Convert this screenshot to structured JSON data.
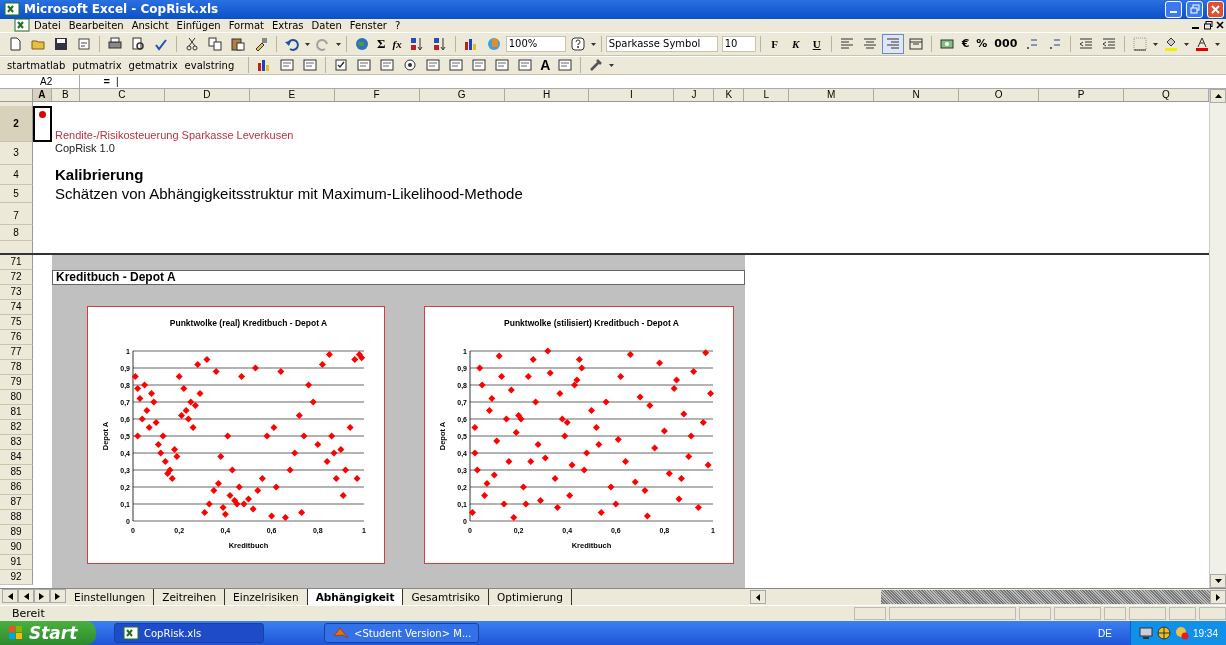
{
  "window": {
    "title": "Microsoft Excel - CopRisk.xls"
  },
  "menu": [
    "Datei",
    "Bearbeiten",
    "Ansicht",
    "Einfügen",
    "Format",
    "Extras",
    "Daten",
    "Fenster",
    "?"
  ],
  "toolbar": {
    "sum": "Σ",
    "function": "fx",
    "zoom": "100%",
    "font": "Sparkasse Symbol",
    "size": "10",
    "format_buttons": [
      {
        "label": "F",
        "kind": "bold"
      },
      {
        "label": "K",
        "kind": "italic"
      },
      {
        "label": "U",
        "kind": "underline"
      }
    ],
    "alignment": [
      {
        "kind": "left",
        "selected": false
      },
      {
        "kind": "center",
        "selected": false
      },
      {
        "kind": "right",
        "selected": true
      },
      {
        "kind": "merge",
        "selected": false
      }
    ],
    "number_buttons": [
      "€",
      "%",
      "000"
    ]
  },
  "macro_buttons": [
    "startmatlab",
    "putmatrix",
    "getmatrix",
    "evalstring"
  ],
  "form_label_glyph": "A",
  "formula_bar": {
    "cell": "A2",
    "equals": "=",
    "value": "|"
  },
  "columns": [
    {
      "label": "A",
      "selected": true
    },
    {
      "label": "B",
      "selected": false
    },
    {
      "label": "C",
      "selected": false
    },
    {
      "label": "D",
      "selected": false
    },
    {
      "label": "E",
      "selected": false
    },
    {
      "label": "F",
      "selected": false
    },
    {
      "label": "G",
      "selected": false
    },
    {
      "label": "H",
      "selected": false
    },
    {
      "label": "I",
      "selected": false
    },
    {
      "label": "J",
      "selected": false
    },
    {
      "label": "K",
      "selected": false
    },
    {
      "label": "L",
      "selected": false
    },
    {
      "label": "M",
      "selected": false
    },
    {
      "label": "N",
      "selected": false
    },
    {
      "label": "O",
      "selected": false
    },
    {
      "label": "P",
      "selected": false
    },
    {
      "label": "Q",
      "selected": false
    }
  ],
  "header_rows": [
    {
      "label": "2",
      "selected": true
    },
    {
      "label": "3",
      "selected": false
    },
    {
      "label": "4",
      "selected": false
    },
    {
      "label": "5",
      "selected": false
    },
    {
      "label": "7",
      "selected": false
    },
    {
      "label": "8",
      "selected": false
    }
  ],
  "title_block": {
    "org": "Rendite-/Risikosteuerung Sparkasse Leverkusen",
    "version": "CopRisk 1.0",
    "heading": "Kalibrierung",
    "subtitle": "Schätzen von Abhängigkeitsstruktur mit Maximum-Likelihood-Methode"
  },
  "lower_rows": [
    "71",
    "72",
    "73",
    "74",
    "75",
    "76",
    "77",
    "78",
    "79",
    "80",
    "81",
    "82",
    "83",
    "84",
    "85",
    "86",
    "87",
    "88",
    "89",
    "90",
    "91",
    "92"
  ],
  "section_title": "Kreditbuch - Depot A",
  "charts": [
    {
      "chart_data": {
        "type": "scatter",
        "grid": true,
        "title": "Punktwolke (real) Kreditbuch - Depot A",
        "xlabel": "Kreditbuch",
        "ylabel": "Depot A",
        "xlim": [
          0,
          1
        ],
        "ylim": [
          0,
          1
        ],
        "xticks": [
          {
            "value": 0,
            "label": "0"
          },
          {
            "value": 0.2,
            "label": "0,2"
          },
          {
            "value": 0.4,
            "label": "0,4"
          },
          {
            "value": 0.6,
            "label": "0,6"
          },
          {
            "value": 0.8,
            "label": "0,8"
          },
          {
            "value": 1,
            "label": "1"
          }
        ],
        "yticks": [
          {
            "value": 0,
            "label": "0"
          },
          {
            "value": 0.1,
            "label": "0,1"
          },
          {
            "value": 0.2,
            "label": "0,2"
          },
          {
            "value": 0.3,
            "label": "0,3"
          },
          {
            "value": 0.4,
            "label": "0,4"
          },
          {
            "value": 0.5,
            "label": "0,5"
          },
          {
            "value": 0.6,
            "label": "0,6"
          },
          {
            "value": 0.7,
            "label": "0,7"
          },
          {
            "value": 0.8,
            "label": "0,8"
          },
          {
            "value": 0.9,
            "label": "0,9"
          },
          {
            "value": 1,
            "label": "1"
          }
        ],
        "x": [
          0.01,
          0.02,
          0.03,
          0.05,
          0.06,
          0.08,
          0.02,
          0.04,
          0.07,
          0.09,
          0.11,
          0.12,
          0.14,
          0.15,
          0.16,
          0.13,
          0.18,
          0.19,
          0.1,
          0.17,
          0.21,
          0.23,
          0.24,
          0.25,
          0.27,
          0.22,
          0.26,
          0.28,
          0.29,
          0.2,
          0.31,
          0.33,
          0.35,
          0.37,
          0.39,
          0.32,
          0.36,
          0.4,
          0.42,
          0.44,
          0.46,
          0.48,
          0.5,
          0.41,
          0.43,
          0.47,
          0.52,
          0.54,
          0.56,
          0.58,
          0.45,
          0.53,
          0.38,
          0.6,
          0.62,
          0.64,
          0.66,
          0.61,
          0.68,
          0.7,
          0.72,
          0.74,
          0.76,
          0.78,
          0.73,
          0.8,
          0.82,
          0.84,
          0.86,
          0.88,
          0.9,
          0.92,
          0.94,
          0.96,
          0.98,
          0.85,
          0.91,
          0.97,
          0.87,
          0.99
        ],
        "series": [
          {
            "color": "#ff0000",
            "values": [
              0.85,
              0.78,
              0.72,
              0.8,
              0.65,
              0.75,
              0.5,
              0.6,
              0.55,
              0.7,
              0.45,
              0.4,
              0.35,
              0.28,
              0.3,
              0.5,
              0.42,
              0.38,
              0.58,
              0.25,
              0.62,
              0.65,
              0.6,
              0.7,
              0.68,
              0.78,
              0.55,
              0.92,
              0.75,
              0.85,
              0.05,
              0.1,
              0.18,
              0.22,
              0.08,
              0.95,
              0.88,
              0.04,
              0.15,
              0.12,
              0.2,
              0.1,
              0.13,
              0.5,
              0.3,
              0.85,
              0.07,
              0.18,
              0.25,
              0.5,
              0.1,
              0.9,
              0.38,
              0.03,
              0.2,
              0.88,
              0.02,
              0.55,
              0.3,
              0.4,
              0.62,
              0.5,
              0.8,
              0.7,
              0.05,
              0.45,
              0.92,
              0.35,
              0.5,
              0.25,
              0.42,
              0.3,
              0.55,
              0.95,
              0.98,
              0.98,
              0.15,
              0.25,
              0.4,
              0.96
            ]
          }
        ]
      }
    },
    {
      "chart_data": {
        "type": "scatter",
        "grid": true,
        "title": "Punktwolke (stilisiert) Kreditbuch - Depot A",
        "xlabel": "Kreditbuch",
        "ylabel": "Depot A",
        "xlim": [
          0,
          1
        ],
        "ylim": [
          0,
          1
        ],
        "xticks": [
          {
            "value": 0,
            "label": "0"
          },
          {
            "value": 0.2,
            "label": "0,2"
          },
          {
            "value": 0.4,
            "label": "0,4"
          },
          {
            "value": 0.6,
            "label": "0,6"
          },
          {
            "value": 0.8,
            "label": "0,8"
          },
          {
            "value": 1,
            "label": "1"
          }
        ],
        "yticks": [
          {
            "value": 0,
            "label": "0"
          },
          {
            "value": 0.1,
            "label": "0,1"
          },
          {
            "value": 0.2,
            "label": "0,2"
          },
          {
            "value": 0.3,
            "label": "0,3"
          },
          {
            "value": 0.4,
            "label": "0,4"
          },
          {
            "value": 0.5,
            "label": "0,5"
          },
          {
            "value": 0.6,
            "label": "0,6"
          },
          {
            "value": 0.7,
            "label": "0,7"
          },
          {
            "value": 0.8,
            "label": "0,8"
          },
          {
            "value": 0.9,
            "label": "0,9"
          },
          {
            "value": 1,
            "label": "1"
          }
        ],
        "x": [
          0.01,
          0.02,
          0.03,
          0.05,
          0.06,
          0.08,
          0.02,
          0.04,
          0.07,
          0.09,
          0.11,
          0.12,
          0.14,
          0.15,
          0.16,
          0.13,
          0.18,
          0.19,
          0.1,
          0.17,
          0.21,
          0.23,
          0.24,
          0.25,
          0.27,
          0.22,
          0.26,
          0.28,
          0.29,
          0.2,
          0.31,
          0.33,
          0.35,
          0.37,
          0.39,
          0.32,
          0.36,
          0.4,
          0.42,
          0.44,
          0.46,
          0.48,
          0.5,
          0.41,
          0.43,
          0.47,
          0.52,
          0.54,
          0.56,
          0.58,
          0.45,
          0.53,
          0.38,
          0.6,
          0.62,
          0.64,
          0.66,
          0.61,
          0.68,
          0.7,
          0.72,
          0.74,
          0.76,
          0.78,
          0.73,
          0.8,
          0.82,
          0.84,
          0.86,
          0.88,
          0.9,
          0.92,
          0.94,
          0.96,
          0.98,
          0.85,
          0.91,
          0.97,
          0.87,
          0.99
        ],
        "series": [
          {
            "color": "#ff0000",
            "values": [
              0.05,
              0.55,
              0.3,
              0.8,
              0.15,
              0.65,
              0.4,
              0.9,
              0.22,
              0.72,
              0.47,
              0.97,
              0.1,
              0.6,
              0.35,
              0.85,
              0.02,
              0.52,
              0.27,
              0.77,
              0.6,
              0.1,
              0.85,
              0.35,
              0.7,
              0.2,
              0.95,
              0.45,
              0.12,
              0.62,
              0.37,
              0.87,
              0.25,
              0.75,
              0.5,
              1,
              0.08,
              0.58,
              0.33,
              0.83,
              0.9,
              0.4,
              0.65,
              0.15,
              0.8,
              0.3,
              0.55,
              0.05,
              0.7,
              0.2,
              0.95,
              0.45,
              0.6,
              0.1,
              0.85,
              0.35,
              0.98,
              0.48,
              0.23,
              0.73,
              0.18,
              0.68,
              0.43,
              0.93,
              0.03,
              0.53,
              0.28,
              0.78,
              0.13,
              0.63,
              0.38,
              0.88,
              0.08,
              0.58,
              0.33,
              0.83,
              0.5,
              0.99,
              0.25,
              0.75
            ]
          }
        ]
      }
    }
  ],
  "sheet_tabs": [
    {
      "label": "Einstellungen",
      "selected": false
    },
    {
      "label": "Zeitreihen",
      "selected": false
    },
    {
      "label": "Einzelrisiken",
      "selected": false
    },
    {
      "label": "Abhängigkeit",
      "selected": true
    },
    {
      "label": "Gesamtrisiko",
      "selected": false
    },
    {
      "label": "Optimierung",
      "selected": false
    }
  ],
  "status_bar": {
    "text": "Bereit"
  },
  "taskbar": {
    "start": "Start",
    "tasks": [
      {
        "label": "CopRisk.xls",
        "kind": "excel"
      },
      {
        "label": "<Student Version> M...",
        "kind": "matlab"
      }
    ],
    "language": "DE",
    "time": "19:34"
  }
}
